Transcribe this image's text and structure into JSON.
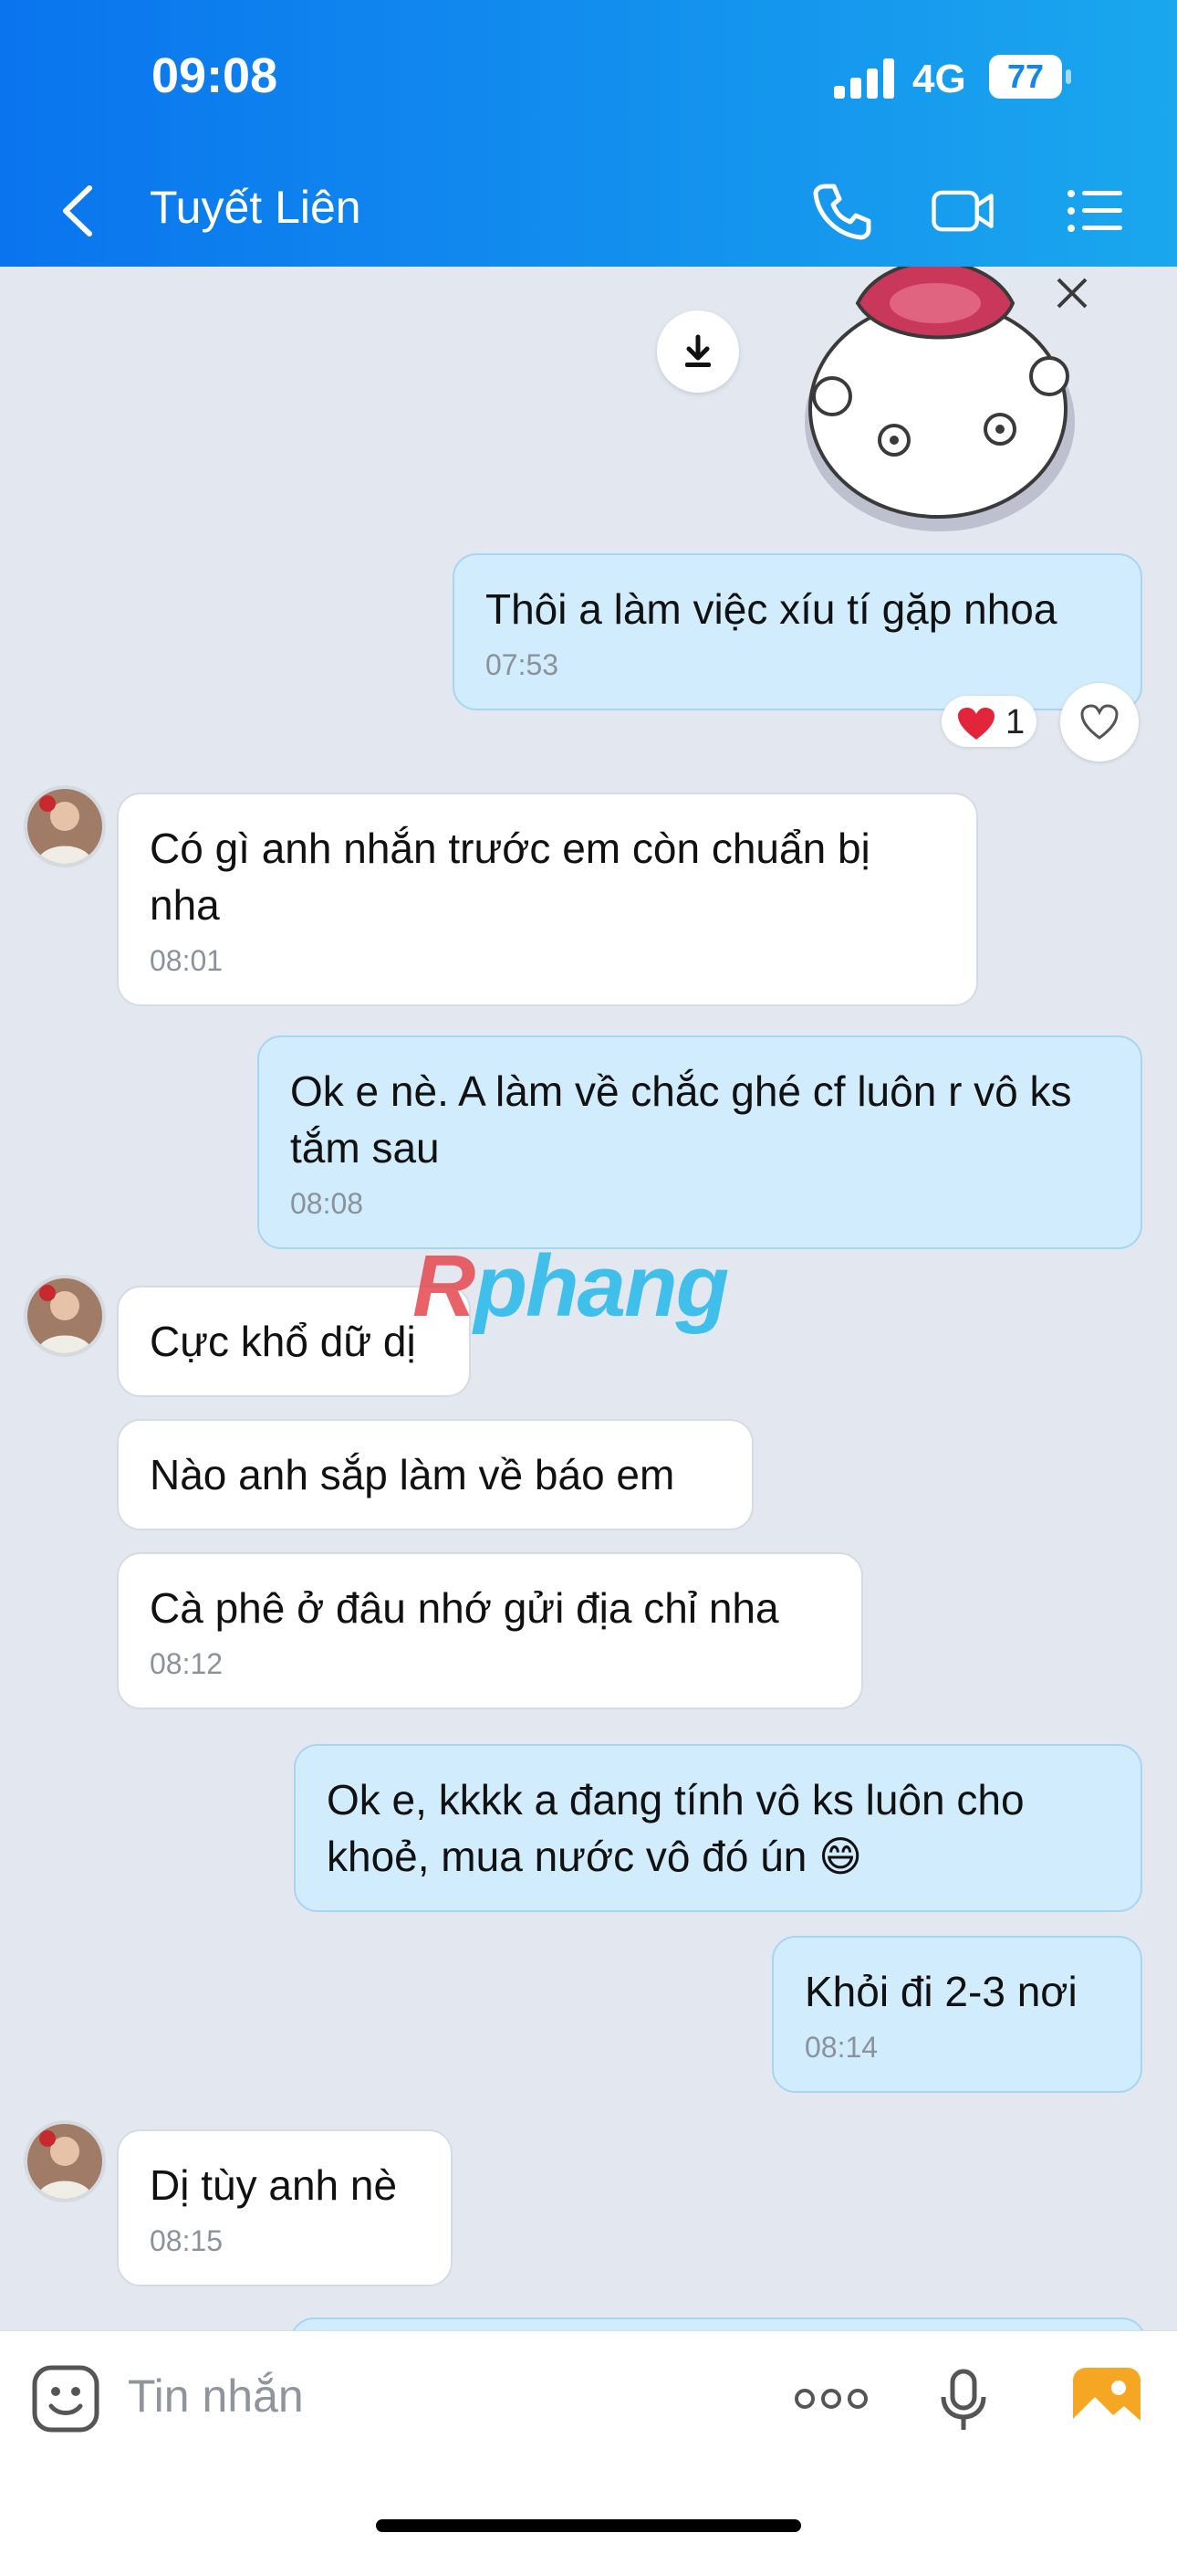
{
  "status_bar": {
    "time": "09:08",
    "network": "4G",
    "battery": "77"
  },
  "header": {
    "title": "Tuyết Liên"
  },
  "messages": [
    {
      "text": "Thôi a làm việc xíu tí gặp nhoa",
      "time": "07:53"
    },
    {
      "text": "Có gì anh nhắn trước em còn chuẩn bị nha",
      "time": "08:01"
    },
    {
      "text": "Ok e nè. A làm về chắc ghé cf luôn r vô ks tắm sau",
      "time": "08:08"
    },
    {
      "text": "Cực khổ dữ dị"
    },
    {
      "text": "Nào anh sắp làm về báo em"
    },
    {
      "text": "Cà phê ở đâu nhớ gửi địa chỉ nha",
      "time": "08:12"
    },
    {
      "text": "Ok e, kkkk a đang tính vô ks luôn cho khoẻ, mua nước vô đó ún 😄"
    },
    {
      "text": "Khỏi đi 2-3 nơi",
      "time": "08:14"
    },
    {
      "text": "Dị tùy anh nè",
      "time": "08:15"
    }
  ],
  "reaction": {
    "count": "1"
  },
  "watermark": {
    "part1": "R",
    "part2": "phang"
  },
  "composer": {
    "placeholder": "Tin nhắn"
  }
}
